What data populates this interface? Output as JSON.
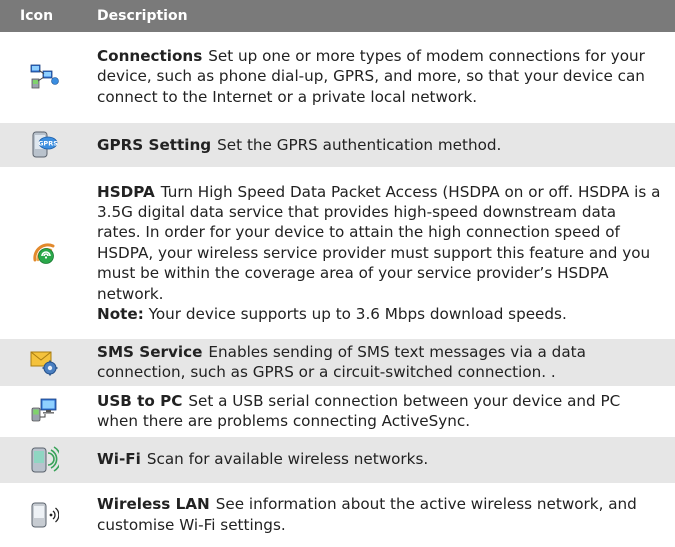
{
  "header": {
    "icon": "Icon",
    "description": "Description"
  },
  "rows": [
    {
      "title": "Connections",
      "text": "Set up one or more types of modem connections for your device, such as phone dial-up, GPRS, and more, so that your device can connect to the Internet or a private local network.",
      "icon": "network-connections-icon"
    },
    {
      "title": "GPRS Setting",
      "text": "Set the GPRS authentication method.",
      "icon": "gprs-device-icon",
      "icon_label": "GPRS"
    },
    {
      "title": "HSDPA",
      "text": "Turn High Speed Data Packet Access (HSDPA on or off. HSDPA is a 3.5G digital data service that provides high-speed downstream data rates. In order for your device to attain the high connection speed of HSDPA, your wireless service provider must support this feature and you must be within the coverage area of your service provider’s HSDPA network.",
      "note_label": "Note:",
      "note_text": "Your device supports up to 3.6 Mbps download speeds.",
      "icon": "hsdpa-signal-icon"
    },
    {
      "title": "SMS Service",
      "text": "Enables sending of SMS text messages via a data connection, such as GPRS or a circuit-switched connection. .",
      "icon": "sms-envelope-gear-icon"
    },
    {
      "title": "USB to PC",
      "text": "Set a USB serial connection between your device and PC when there are problems connecting ActiveSync.",
      "icon": "usb-computer-icon"
    },
    {
      "title": "Wi-Fi",
      "text": "Scan for available wireless networks.",
      "icon": "wifi-device-icon"
    },
    {
      "title": "Wireless LAN",
      "text": "See information about the active wireless network, and customise Wi-Fi settings.",
      "icon": "wireless-lan-device-icon"
    }
  ]
}
